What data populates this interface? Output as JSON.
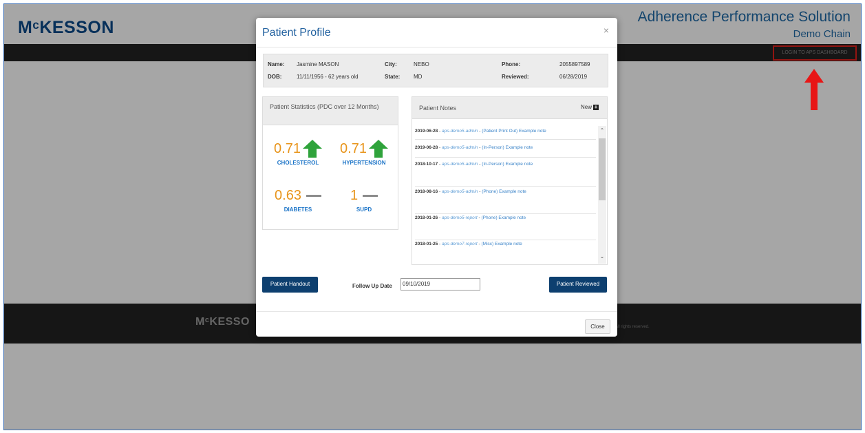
{
  "header": {
    "logo": "MᶜKESSON",
    "app_title": "Adherence Performance Solution",
    "app_subtitle": "Demo Chain"
  },
  "navbar": {
    "login_link": "LOGIN TO APS DASHBOARD"
  },
  "footer": {
    "logo": "MᶜKESSO",
    "rights": "All rights reserved."
  },
  "colors": {
    "brand_blue": "#0b4a8a",
    "stat_orange": "#e8951c",
    "stat_label_blue": "#1a73c7",
    "arrow_green": "#2fa33b",
    "highlight_red": "#e0201b",
    "button_navy": "#0d3f6f"
  },
  "modal": {
    "title": "Patient Profile",
    "close_icon": "×",
    "patient": {
      "name_label": "Name:",
      "name": "Jasmine MASON",
      "dob_label": "DOB:",
      "dob": "11/11/1956 - 62 years old",
      "city_label": "City:",
      "city": "NEBO",
      "state_label": "State:",
      "state": "MD",
      "phone_label": "Phone:",
      "phone": "2055897589",
      "reviewed_label": "Reviewed:",
      "reviewed": "06/28/2019"
    },
    "stats": {
      "title": "Patient Statistics (PDC over 12 Months)",
      "items": [
        {
          "value": "0.71",
          "label": "CHOLESTEROL",
          "trend_icon": "up-arrow-icon"
        },
        {
          "value": "0.71",
          "label": "HYPERTENSION",
          "trend_icon": "up-arrow-icon"
        },
        {
          "value": "0.63",
          "label": "DIABETES",
          "trend_icon": "dash-icon"
        },
        {
          "value": "1",
          "label": "SUPD",
          "trend_icon": "dash-icon"
        }
      ]
    },
    "notes": {
      "title": "Patient Notes",
      "new_label": "New",
      "items": [
        {
          "date": "2019-06-28",
          "user": "aps-demo5-admin",
          "detail": "(Patient Print Out) Example note"
        },
        {
          "date": "2019-06-28",
          "user": "aps-demo5-admin",
          "detail": "(In-Person) Example note"
        },
        {
          "date": "2018-10-17",
          "user": "aps-demo5-admin",
          "detail": "(In-Person) Example note"
        },
        {
          "date": "2018-08-16",
          "user": "aps-demo5-admin",
          "detail": "(Phone) Example note"
        },
        {
          "date": "2018-01-26",
          "user": "aps-demo5-report",
          "detail": "(Phone) Example note"
        },
        {
          "date": "2018-01-25",
          "user": "aps-demo7-report",
          "detail": "(Misc) Example note"
        }
      ]
    },
    "handout_button": "Patient Handout",
    "followup_label": "Follow Up Date",
    "followup_value": "09/10/2019",
    "reviewed_button": "Patient Reviewed",
    "close_button": "Close"
  }
}
